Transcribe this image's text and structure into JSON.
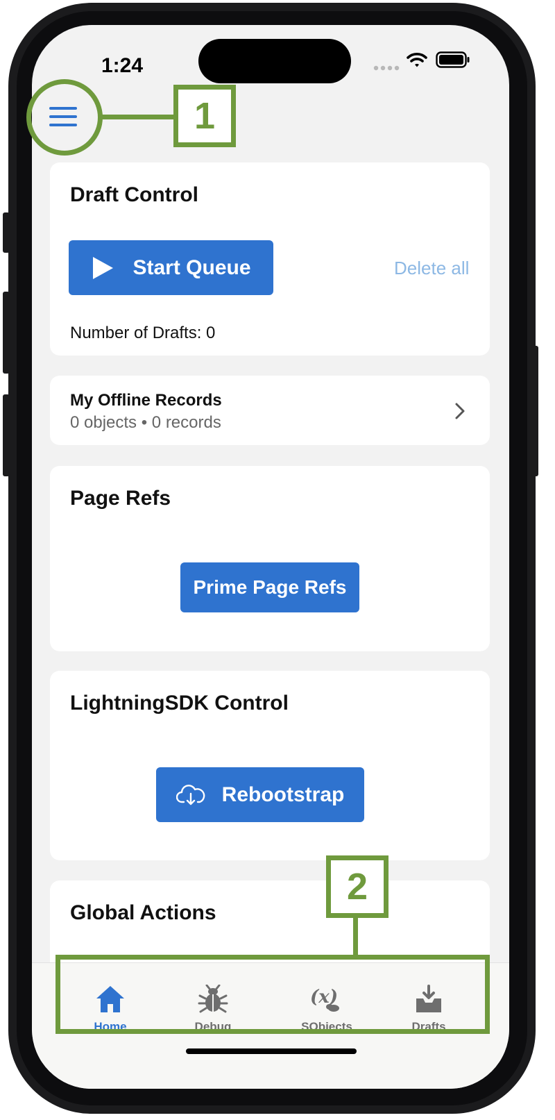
{
  "status_bar": {
    "time": "1:24"
  },
  "annotations": {
    "menu_callout": "1",
    "tabbar_callout": "2"
  },
  "draft_control": {
    "title": "Draft Control",
    "start_queue_label": "Start Queue",
    "delete_all_label": "Delete all",
    "drafts_count_text": "Number of Drafts: 0"
  },
  "offline_records": {
    "title": "My Offline Records",
    "subtitle": "0 objects • 0 records"
  },
  "page_refs": {
    "title": "Page Refs",
    "button_label": "Prime Page Refs"
  },
  "lightning_sdk": {
    "title": "LightningSDK Control",
    "button_label": "Rebootstrap"
  },
  "global_actions": {
    "title": "Global Actions"
  },
  "tabs": [
    {
      "label": "Home",
      "icon": "home-icon",
      "active": true
    },
    {
      "label": "Debug",
      "icon": "bug-icon",
      "active": false
    },
    {
      "label": "SObjects",
      "icon": "variable-icon",
      "active": false
    },
    {
      "label": "Drafts",
      "icon": "download-tray-icon",
      "active": false
    }
  ],
  "colors": {
    "accent": "#2f73cf",
    "annotation": "#6f9a3d",
    "inactive_tab": "#6e6e6e",
    "faded_link": "#8db8e4"
  }
}
